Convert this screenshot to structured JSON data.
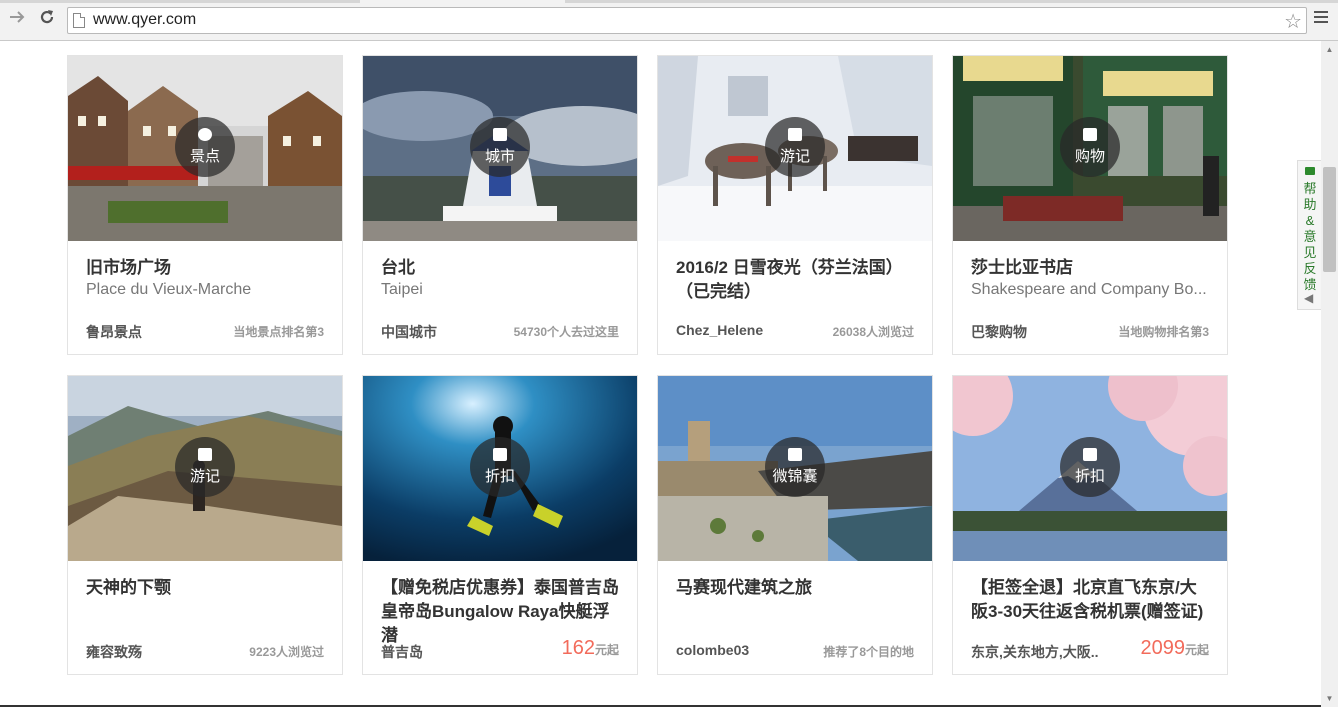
{
  "browser": {
    "url": "www.qyer.com",
    "back_icon": "arrow-right-icon",
    "reload_icon": "reload-icon",
    "bookmark_icon": "star-icon"
  },
  "feedback": {
    "label": "帮助&意见反馈"
  },
  "cards": [
    {
      "badge": "景点",
      "title": "旧市场广场",
      "subtitle": "Place du Vieux-Marche",
      "foot_left": "鲁昂景点",
      "foot_right": "当地景点排名第3"
    },
    {
      "badge": "城市",
      "title": "台北",
      "subtitle": "Taipei",
      "foot_left": "中国城市",
      "foot_right": "54730个人去过这里"
    },
    {
      "badge": "游记",
      "title": "2016/2 日雪夜光（芬兰法国）（已完结）",
      "subtitle": "",
      "foot_left": "Chez_Helene",
      "foot_right": "26038人浏览过"
    },
    {
      "badge": "购物",
      "title": "莎士比亚书店",
      "subtitle": "Shakespeare and Company Bo...",
      "foot_left": "巴黎购物",
      "foot_right": "当地购物排名第3"
    },
    {
      "badge": "游记",
      "title": "天神的下颚",
      "subtitle": "",
      "foot_left": "雍容致殇",
      "foot_right": "9223人浏览过"
    },
    {
      "badge": "折扣",
      "title": "【赠免税店优惠券】泰国普吉岛皇帝岛Bungalow Raya快艇浮潜",
      "subtitle": "",
      "foot_left": "普吉岛",
      "price": "162",
      "price_unit": "元起"
    },
    {
      "badge": "微锦囊",
      "title": "马赛现代建筑之旅",
      "subtitle": "",
      "foot_left": "colombe03",
      "foot_right": "推荐了8个目的地"
    },
    {
      "badge": "折扣",
      "title": "【拒签全退】北京直飞东京/大阪3-30天往返含税机票(赠签证)",
      "subtitle": "",
      "foot_left": "东京,关东地方,大阪..",
      "price": "2099",
      "price_unit": "元起"
    }
  ]
}
